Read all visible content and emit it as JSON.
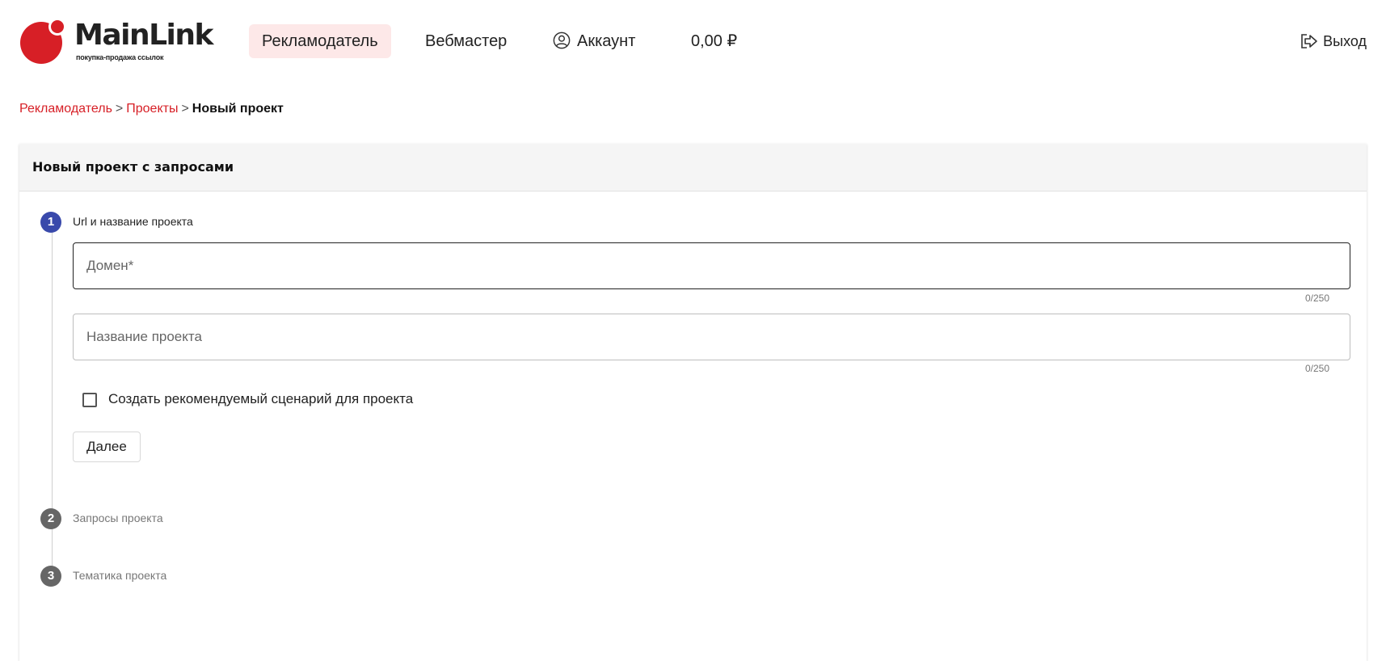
{
  "header": {
    "logo": {
      "name": "MainLink",
      "tagline": "покупка-продажа ссылок",
      "brand_color": "#d71f26"
    },
    "nav": [
      {
        "label": "Рекламодатель",
        "active": true
      },
      {
        "label": "Вебмастер",
        "active": false
      },
      {
        "label": "Аккаунт",
        "icon": "account-icon"
      },
      {
        "label": "0,00 ₽"
      }
    ],
    "exit_label": "Выход"
  },
  "breadcrumb": {
    "items": [
      "Рекламодатель",
      "Проекты"
    ],
    "separator": ">",
    "current": "Новый проект"
  },
  "card": {
    "title": "Новый проект с запросами",
    "steps": [
      {
        "number": "1",
        "label": "Url и название проекта",
        "state": "active"
      },
      {
        "number": "2",
        "label": "Запросы проекта",
        "state": "idle"
      },
      {
        "number": "3",
        "label": "Тематика проекта",
        "state": "idle"
      }
    ],
    "domain_field": {
      "placeholder": "Домен*",
      "value": "",
      "counter": "0/250"
    },
    "name_field": {
      "placeholder": "Название проекта",
      "value": "",
      "counter": "0/250"
    },
    "checkbox": {
      "label": "Создать рекомендуемый сценарий для проекта",
      "checked": false
    },
    "next_button": "Далее"
  }
}
